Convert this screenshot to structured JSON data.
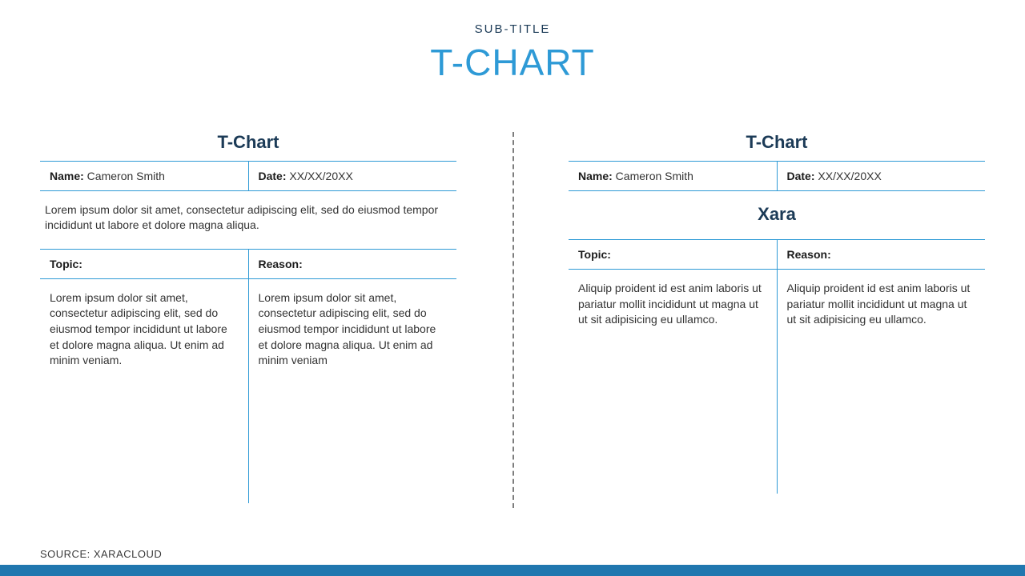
{
  "header": {
    "subtitle": "SUB-TITLE",
    "title": "T-CHART"
  },
  "left": {
    "heading": "T-Chart",
    "name_label": "Name:",
    "name_value": " Cameron Smith",
    "date_label": "Date:",
    "date_value": " XX/XX/20XX",
    "description": "Lorem ipsum dolor sit amet, consectetur adipiscing elit, sed do eiusmod tempor incididunt ut labore et dolore magna aliqua.",
    "topic_label": "Topic:",
    "reason_label": "Reason:",
    "topic_text": "Lorem ipsum dolor sit amet, consectetur adipiscing elit, sed do eiusmod tempor incididunt ut labore et dolore magna aliqua. Ut enim ad minim veniam.",
    "reason_text": "Lorem ipsum dolor sit amet, consectetur adipiscing elit, sed do eiusmod tempor incididunt ut labore et dolore magna aliqua. Ut enim ad minim veniam"
  },
  "right": {
    "heading": "T-Chart",
    "name_label": "Name:",
    "name_value": " Cameron Smith",
    "date_label": "Date:",
    "date_value": " XX/XX/20XX",
    "center_heading": "Xara",
    "topic_label": "Topic:",
    "reason_label": "Reason:",
    "topic_text": "Aliquip proident id est anim laboris ut pariatur mollit incididunt ut magna ut ut sit adipisicing eu ullamco.",
    "reason_text": "Aliquip proident id est anim laboris ut pariatur mollit incididunt ut magna ut ut sit adipisicing eu ullamco."
  },
  "source": "SOURCE: XARACLOUD"
}
